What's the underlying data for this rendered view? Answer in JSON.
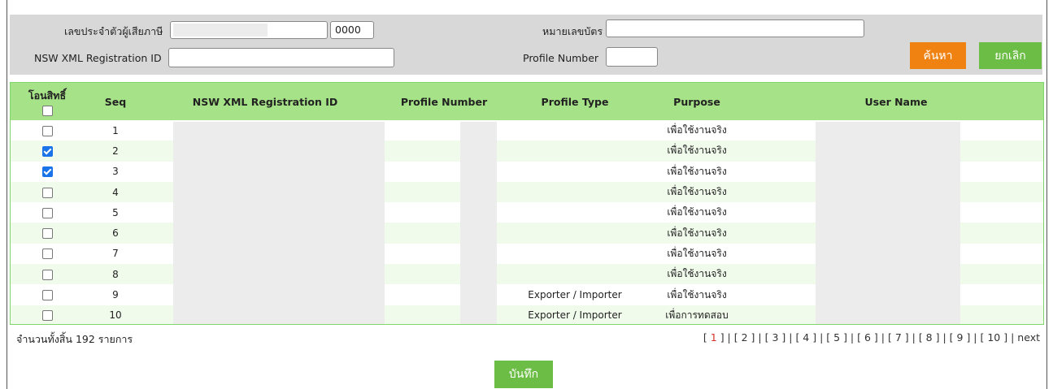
{
  "search": {
    "taxid_label": "เลขประจำตัวผู้เสียภาษี",
    "taxid_value": "",
    "branch_value": "0000",
    "card_label": "หมายเลขบัตร",
    "card_value": "",
    "nsw_label": "NSW XML Registration ID",
    "nsw_value": "",
    "profile_label": "Profile Number",
    "profile_value": "",
    "search_button": "ค้นหา",
    "cancel_button": "ยกเลิก"
  },
  "table": {
    "headers": {
      "select": "โอนสิทธิ์",
      "seq": "Seq",
      "nsw": "NSW XML Registration ID",
      "profile_number": "Profile Number",
      "profile_type": "Profile Type",
      "purpose": "Purpose",
      "user_name": "User Name"
    },
    "rows": [
      {
        "checked": false,
        "seq": "1",
        "profile_type": "",
        "purpose": "เพื่อใช้งานจริง"
      },
      {
        "checked": true,
        "seq": "2",
        "profile_type": "",
        "purpose": "เพื่อใช้งานจริง"
      },
      {
        "checked": true,
        "seq": "3",
        "profile_type": "",
        "purpose": "เพื่อใช้งานจริง"
      },
      {
        "checked": false,
        "seq": "4",
        "profile_type": "",
        "purpose": "เพื่อใช้งานจริง"
      },
      {
        "checked": false,
        "seq": "5",
        "profile_type": "",
        "purpose": "เพื่อใช้งานจริง"
      },
      {
        "checked": false,
        "seq": "6",
        "profile_type": "",
        "purpose": "เพื่อใช้งานจริง"
      },
      {
        "checked": false,
        "seq": "7",
        "profile_type": "",
        "purpose": "เพื่อใช้งานจริง"
      },
      {
        "checked": false,
        "seq": "8",
        "profile_type": "",
        "purpose": "เพื่อใช้งานจริง"
      },
      {
        "checked": false,
        "seq": "9",
        "profile_type": "Exporter / Importer",
        "purpose": "เพื่อใช้งานจริง"
      },
      {
        "checked": false,
        "seq": "10",
        "profile_type": "Exporter / Importer",
        "purpose": "เพื่อการทดสอบ"
      }
    ]
  },
  "footer": {
    "total_text": "จำนวนทั้งสิ้น 192 รายการ",
    "pages": [
      "1",
      "2",
      "3",
      "4",
      "5",
      "6",
      "7",
      "8",
      "9",
      "10"
    ],
    "current_page": "1",
    "next_label": "next",
    "save_button": "บันทึก"
  }
}
